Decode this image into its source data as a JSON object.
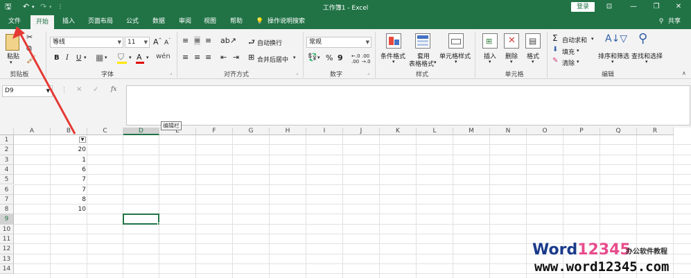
{
  "window": {
    "title": "工作簿1  -  Excel",
    "login_label": "登录",
    "share_label": "共享"
  },
  "tabs": [
    "文件",
    "开始",
    "插入",
    "页面布局",
    "公式",
    "数据",
    "审阅",
    "视图",
    "帮助"
  ],
  "tell_me": "操作说明搜索",
  "ribbon": {
    "clipboard": {
      "paste": "粘贴",
      "group": "剪贴板"
    },
    "font": {
      "name": "等线",
      "size": "11",
      "group": "字体",
      "bold": "B",
      "italic": "I",
      "underline": "U"
    },
    "alignment": {
      "wrap": "自动换行",
      "merge": "合并后居中",
      "group": "对齐方式"
    },
    "number": {
      "format": "常规",
      "group": "数字",
      "percent": "%",
      "comma": "9"
    },
    "styles": {
      "conditional": "条件格式",
      "table_line1": "套用",
      "table_line2": "表格格式",
      "cell_styles": "单元格样式",
      "group": "样式"
    },
    "cells": {
      "insert": "插入",
      "delete": "删除",
      "format": "格式",
      "group": "单元格"
    },
    "editing": {
      "autosum": "自动求和",
      "fill": "填充",
      "clear": "清除",
      "sort": "排序和筛选",
      "find": "查找和选择",
      "group": "编辑"
    }
  },
  "formula_bar": {
    "name_box": "D9",
    "fx": "fx",
    "tooltip": "编辑栏"
  },
  "sheet": {
    "columns": [
      "A",
      "B",
      "C",
      "D",
      "E",
      "F",
      "G",
      "H",
      "I",
      "J",
      "K",
      "L",
      "M",
      "N",
      "O",
      "P",
      "Q",
      "R"
    ],
    "rows": [
      "1",
      "2",
      "3",
      "4",
      "5",
      "6",
      "7",
      "8",
      "9",
      "10",
      "11",
      "12",
      "13",
      "14"
    ],
    "column_b_values": [
      "20",
      "1",
      "6",
      "7",
      "7",
      "8",
      "10"
    ],
    "selected_cell": "D9"
  },
  "colors": {
    "excel_green": "#217346",
    "ribbon_bg": "#f3f3f3",
    "arrow": "#e53935"
  },
  "watermark": {
    "brand_a": "Word",
    "brand_b": "12345",
    "tagline": "办公软件教程",
    "url": "www.word12345.com"
  }
}
